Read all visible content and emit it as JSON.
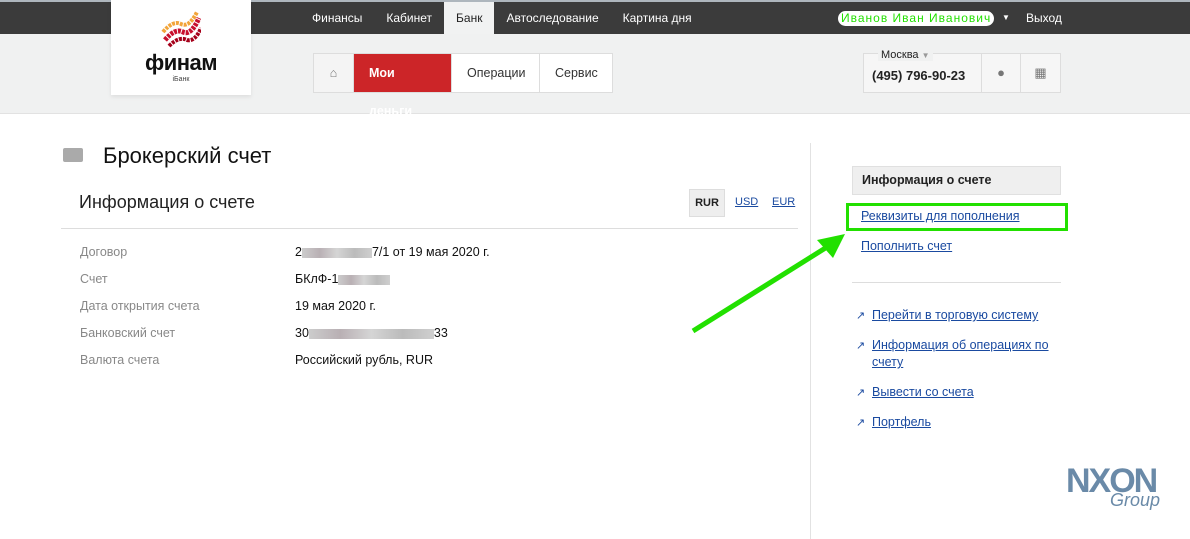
{
  "topnav": {
    "items": [
      "Финансы",
      "Кабинет",
      "Банк",
      "Автоследование",
      "Картина дня"
    ],
    "active": "Банк",
    "user": "Иванов Иван Иванович",
    "logout": "Выход"
  },
  "logo": {
    "name": "финам",
    "sub": "iБанк"
  },
  "mainnav": {
    "items": [
      "Мои деньги",
      "Операции",
      "Сервис"
    ]
  },
  "contact": {
    "city": "Москва",
    "phone": "(495) 796-90-23"
  },
  "page": {
    "title": "Брокерский счет",
    "section": "Информация о счете",
    "currencies": [
      "RUR",
      "USD",
      "EUR"
    ],
    "selected_currency": "RUR",
    "rows": [
      {
        "label": "Договор",
        "prefix": "2",
        "value": "7/1 от 19 мая 2020 г."
      },
      {
        "label": "Счет",
        "prefix": "БКлФ-1",
        "value": ""
      },
      {
        "label": "Дата открытия счета",
        "prefix": "",
        "value": "19 мая 2020 г."
      },
      {
        "label": "Банковский счет",
        "prefix": "30",
        "value": "33"
      },
      {
        "label": "Валюта счета",
        "prefix": "",
        "value": "Российский рубль, RUR"
      }
    ]
  },
  "sidebar": {
    "header": "Информация о счете",
    "links": [
      "Реквизиты для пополнения",
      "Пополнить счет"
    ],
    "ext_links": [
      "Перейти в торговую систему",
      "Информация об операциях по счету",
      "Вывести со счета",
      "Портфель"
    ]
  },
  "watermark": {
    "text": "NXON",
    "sub": "Group"
  },
  "colors": {
    "accent_red": "#cc2528",
    "highlight": "#22e000",
    "link": "#1a4aa0"
  }
}
